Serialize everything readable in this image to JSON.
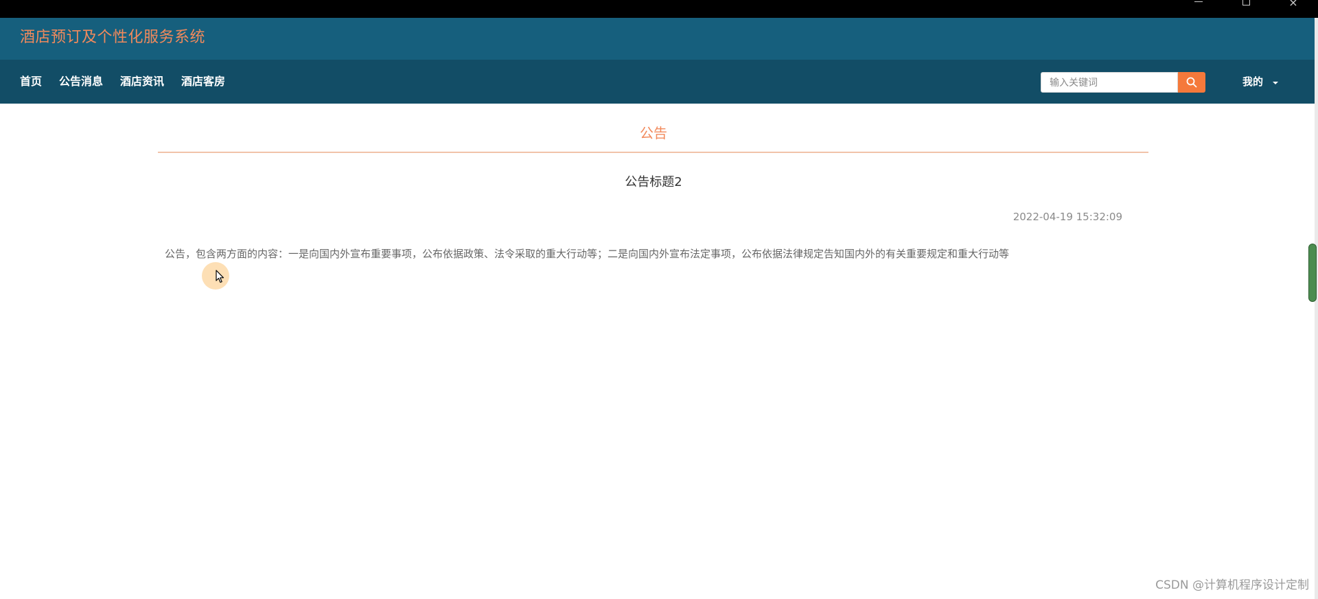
{
  "window": {
    "minimize_icon": "minimize-icon",
    "maximize_icon": "restore-icon",
    "close_icon": "close-icon",
    "close_glyph": "×"
  },
  "header": {
    "site_title": "酒店预订及个性化服务系统",
    "title_color": "#f28a5c",
    "brand_bg": "#165f7d",
    "nav_bg": "#124d66"
  },
  "nav": {
    "items": [
      {
        "label": "首页"
      },
      {
        "label": "公告消息"
      },
      {
        "label": "酒店资讯"
      },
      {
        "label": "酒店客房"
      }
    ]
  },
  "search": {
    "placeholder": "输入关键词",
    "value": "",
    "button_icon": "search-icon",
    "button_color": "#f5793b"
  },
  "user_menu": {
    "label": "我的",
    "icon": "caret-down-icon"
  },
  "section": {
    "heading": "公告"
  },
  "notice": {
    "title": "公告标题2",
    "datetime": "2022-04-19 15:32:09",
    "body": "公告，包含两方面的内容：一是向国内外宣布重要事项，公布依据政策、法令采取的重大行动等；二是向国内外宣布法定事项，公布依据法律规定告知国内外的有关重要规定和重大行动等"
  },
  "watermark": "CSDN @计算机程序设计定制"
}
